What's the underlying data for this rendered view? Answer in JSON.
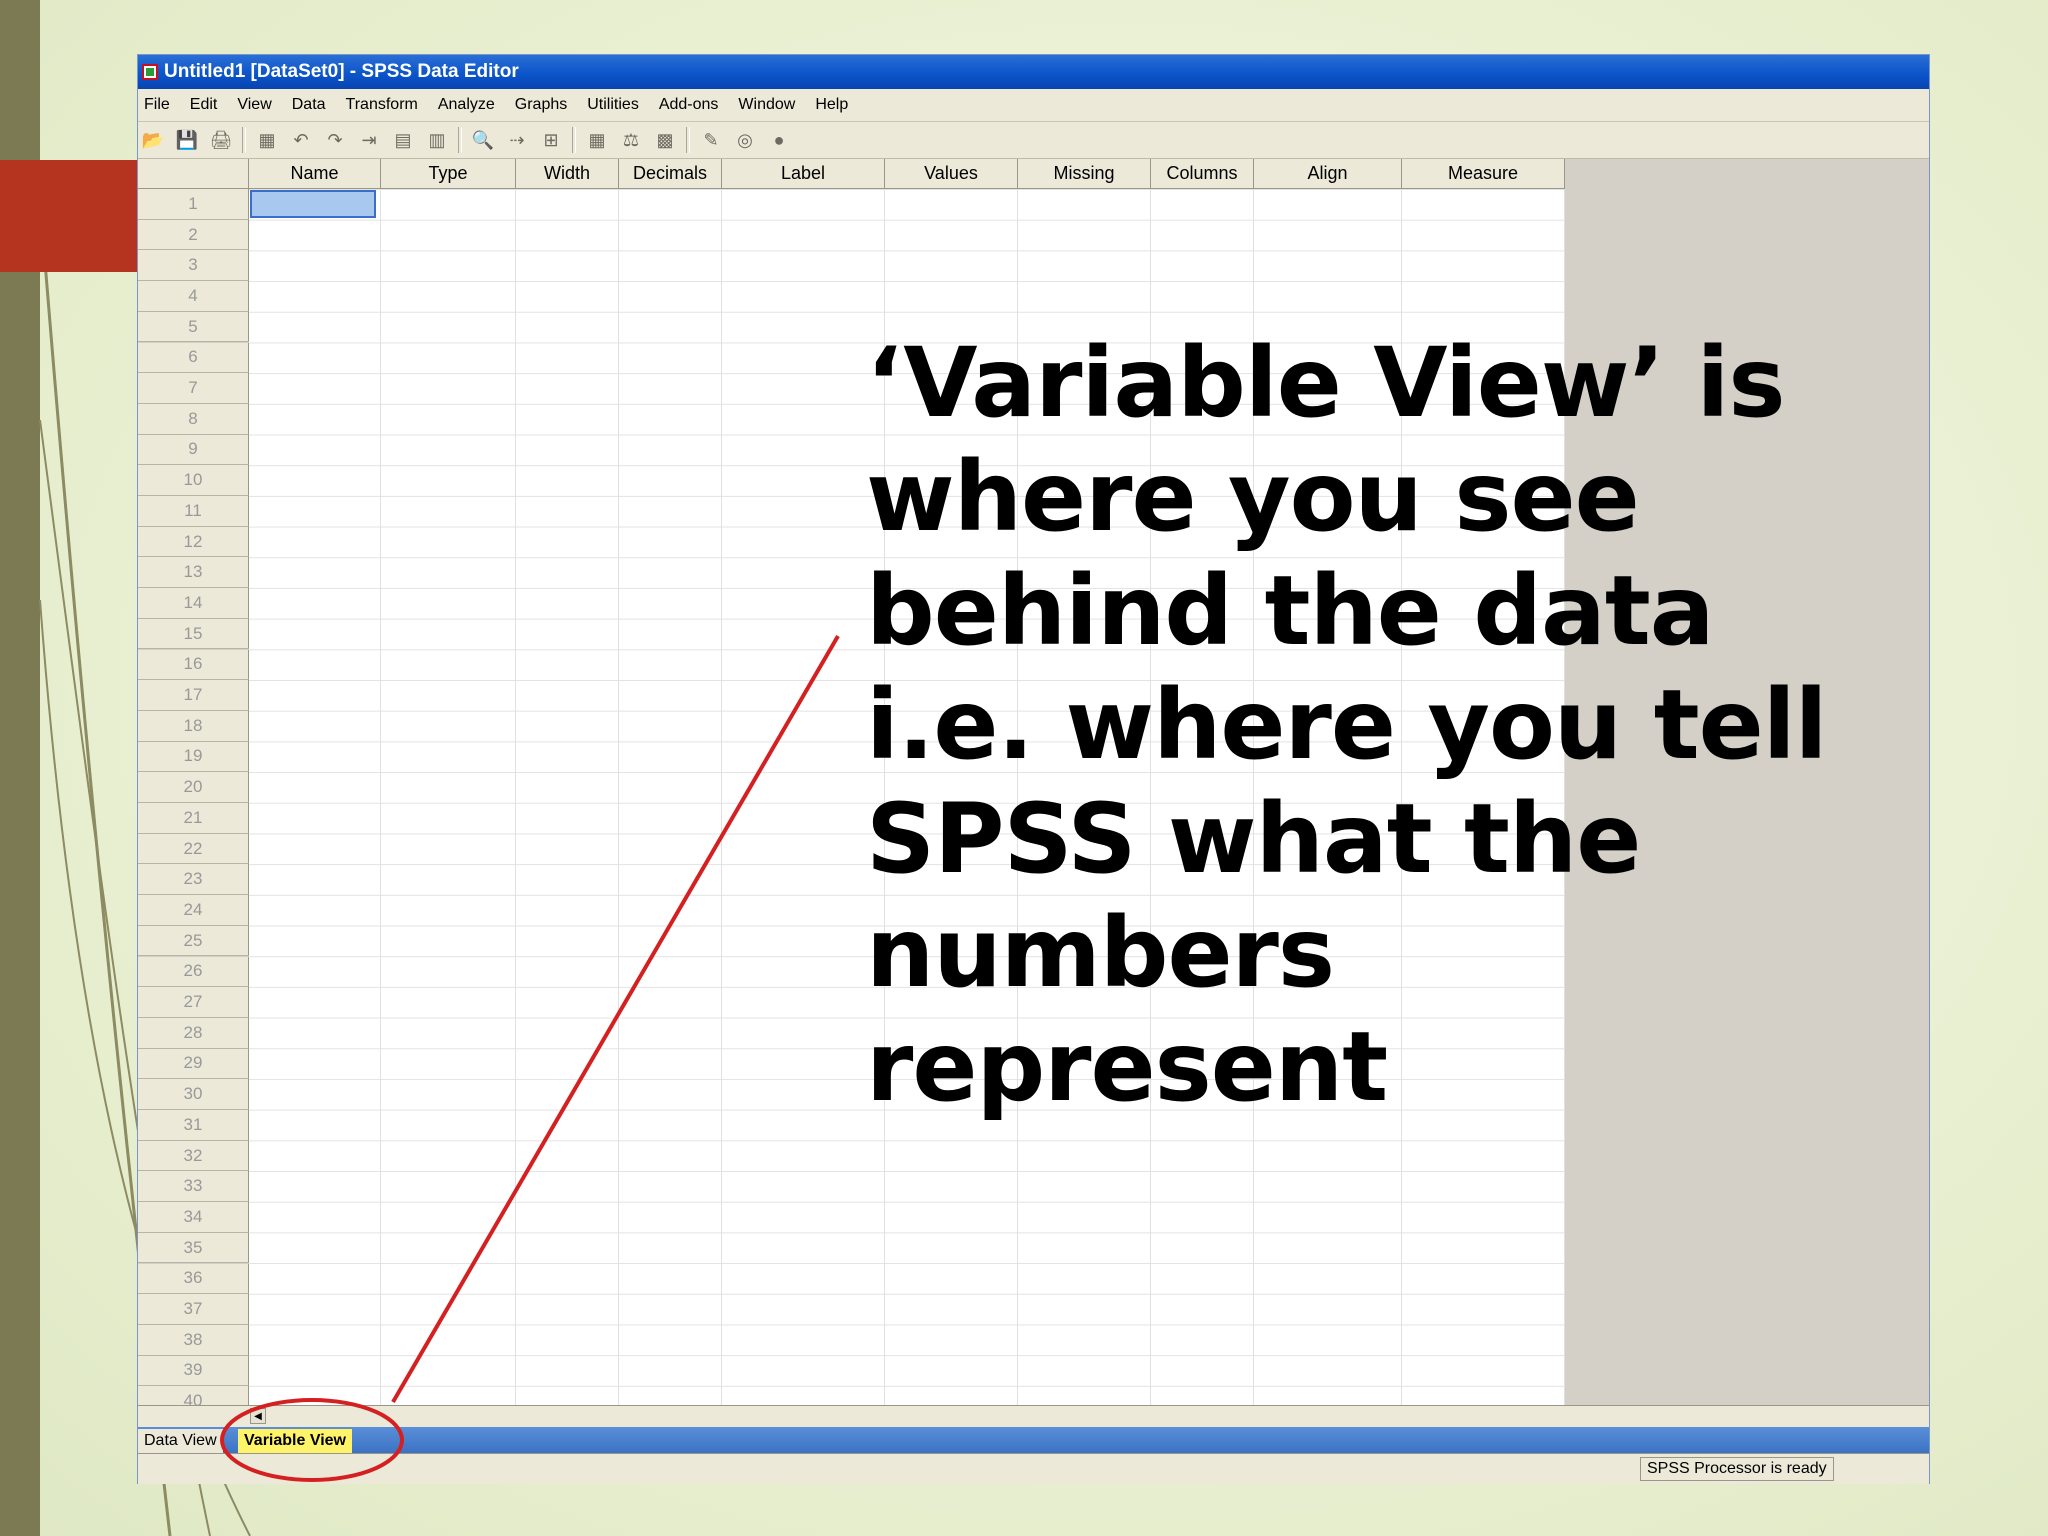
{
  "window": {
    "title": "Untitled1 [DataSet0] - SPSS Data Editor"
  },
  "menu": [
    {
      "label": "File"
    },
    {
      "label": "Edit"
    },
    {
      "label": "View"
    },
    {
      "label": "Data"
    },
    {
      "label": "Transform"
    },
    {
      "label": "Analyze"
    },
    {
      "label": "Graphs"
    },
    {
      "label": "Utilities"
    },
    {
      "label": "Add-ons"
    },
    {
      "label": "Window"
    },
    {
      "label": "Help"
    }
  ],
  "toolbar_icons": [
    "open-icon",
    "save-icon",
    "print-icon",
    "dialog-recall-icon",
    "undo-icon",
    "redo-icon",
    "goto-case-icon",
    "goto-variable-icon",
    "variables-icon",
    "find-icon",
    "insert-cases-icon",
    "insert-variable-icon",
    "split-file-icon",
    "weight-cases-icon",
    "select-cases-icon",
    "value-labels-icon",
    "use-sets-icon",
    "show-all-variables-icon"
  ],
  "columns": [
    "Name",
    "Type",
    "Width",
    "Decimals",
    "Label",
    "Values",
    "Missing",
    "Columns",
    "Align",
    "Measure"
  ],
  "rows": [
    "1",
    "2",
    "3",
    "4",
    "5",
    "6",
    "7",
    "8",
    "9",
    "10",
    "11",
    "12",
    "13",
    "14",
    "15",
    "16",
    "17",
    "18",
    "19",
    "20",
    "21",
    "22",
    "23",
    "24",
    "25",
    "26",
    "27",
    "28",
    "29",
    "30",
    "31",
    "32",
    "33",
    "34",
    "35",
    "36",
    "37",
    "38",
    "39",
    "40"
  ],
  "tabs": {
    "data_view": "Data View",
    "variable_view": "Variable View"
  },
  "status": "SPSS  Processor is ready",
  "caption_lines": [
    "‘Variable View’ is",
    "where you see",
    "behind the data",
    "i.e. where you tell",
    "SPSS what the",
    "numbers",
    "represent"
  ],
  "colors": {
    "accent_red": "#b5341f",
    "annotation_red": "#d42020",
    "titlebar_blue": "#0a53c9",
    "active_tab": "#fff36a"
  }
}
